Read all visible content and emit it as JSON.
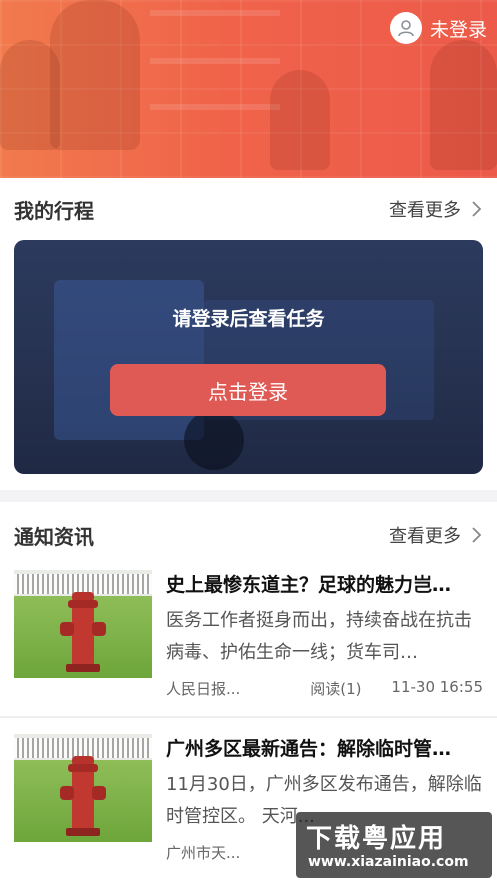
{
  "header": {
    "user_label": "未登录",
    "avatar_icon": "user-icon"
  },
  "trip": {
    "title": "我的行程",
    "more_label": "查看更多",
    "message": "请登录后查看任务",
    "login_button": "点击登录"
  },
  "news": {
    "title": "通知资讯",
    "more_label": "查看更多",
    "items": [
      {
        "title": "史上最惨东道主？足球的魅力岂…",
        "summary": "医务工作者挺身而出，持续奋战在抗击病毒、护佑生命一线；货车司…",
        "source": "人民日报...",
        "reads": "阅读(1)",
        "time": "11-30 16:55"
      },
      {
        "title": "广州多区最新通告：解除临时管…",
        "summary": "11月30日，广州多区发布通告，解除临时管控区。         天河...",
        "source": "广州市天...",
        "reads": "",
        "time": ""
      }
    ]
  },
  "watermark": {
    "main": "下载粤应用",
    "sub": "www.xiazainiao.com"
  },
  "colors": {
    "banner": "#f0634a",
    "login_button": "#e05a55",
    "trip_card": "#263250"
  }
}
